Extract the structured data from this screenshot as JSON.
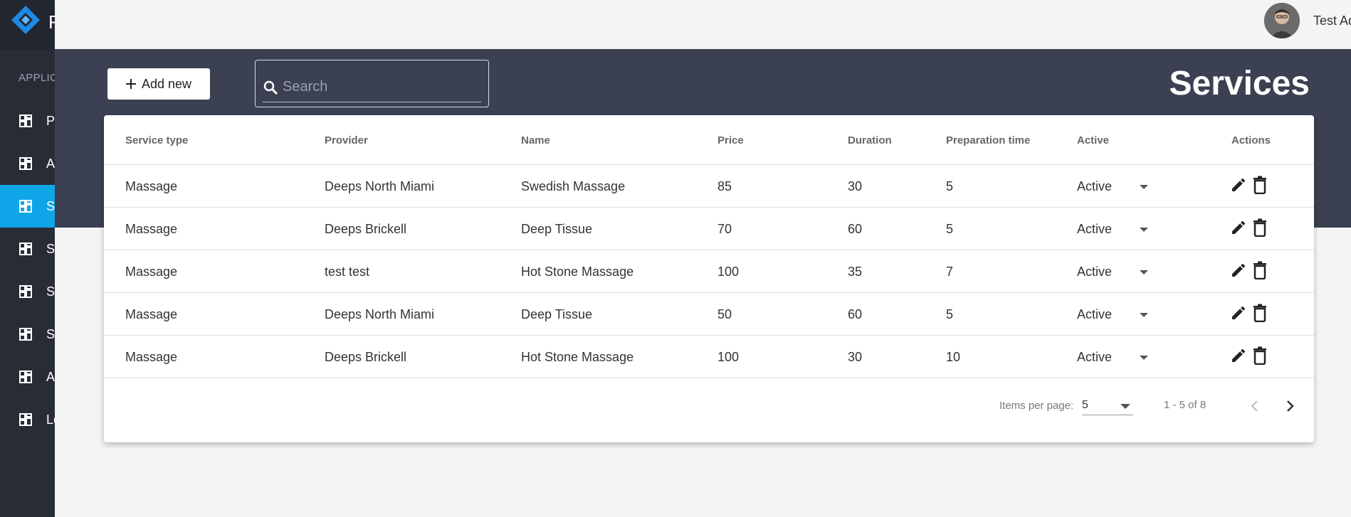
{
  "sidebar": {
    "brand_initial": "F",
    "section_label": "APPLIC",
    "items": [
      {
        "label": "P",
        "active": false
      },
      {
        "label": "A",
        "active": false
      },
      {
        "label": "S",
        "active": true
      },
      {
        "label": "S",
        "active": false
      },
      {
        "label": "S",
        "active": false
      },
      {
        "label": "S",
        "active": false
      },
      {
        "label": "A",
        "active": false
      },
      {
        "label": "Lo",
        "active": false
      }
    ]
  },
  "topbar": {
    "user_name": "Test Admin"
  },
  "toolbar": {
    "add_label": "Add new",
    "search_placeholder": "Search",
    "page_title": "Services"
  },
  "table": {
    "headers": [
      "Service type",
      "Provider",
      "Name",
      "Price",
      "Duration",
      "Preparation time",
      "Active",
      "Actions"
    ],
    "rows": [
      {
        "service_type": "Massage",
        "provider": "Deeps North Miami",
        "name": "Swedish Massage",
        "price": "85",
        "duration": "30",
        "prep": "5",
        "active": "Active"
      },
      {
        "service_type": "Massage",
        "provider": "Deeps Brickell",
        "name": "Deep Tissue",
        "price": "70",
        "duration": "60",
        "prep": "5",
        "active": "Active"
      },
      {
        "service_type": "Massage",
        "provider": "test test",
        "name": "Hot Stone Massage",
        "price": "100",
        "duration": "35",
        "prep": "7",
        "active": "Active"
      },
      {
        "service_type": "Massage",
        "provider": "Deeps North Miami",
        "name": "Deep Tissue",
        "price": "50",
        "duration": "60",
        "prep": "5",
        "active": "Active"
      },
      {
        "service_type": "Massage",
        "provider": "Deeps Brickell",
        "name": "Hot Stone Massage",
        "price": "100",
        "duration": "30",
        "prep": "10",
        "active": "Active"
      }
    ]
  },
  "paginator": {
    "items_per_page_label": "Items per page:",
    "items_per_page_value": "5",
    "range_label": "1 - 5 of 8"
  },
  "colors": {
    "sidebar_bg": "#282c37",
    "band_bg": "#3b4152",
    "accent": "#0ea5e9"
  }
}
